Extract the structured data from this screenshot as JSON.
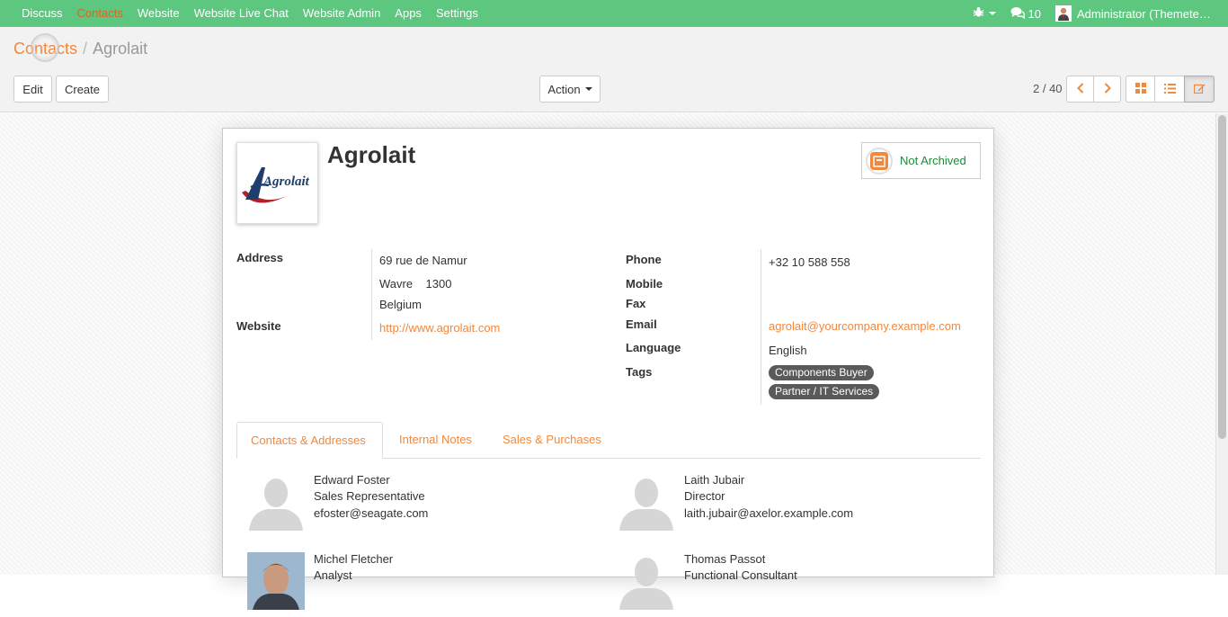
{
  "topbar": {
    "menu": [
      {
        "label": "Discuss",
        "active": false
      },
      {
        "label": "Contacts",
        "active": true
      },
      {
        "label": "Website",
        "active": false
      },
      {
        "label": "Website Live Chat",
        "active": false
      },
      {
        "label": "Website Admin",
        "active": false
      },
      {
        "label": "Apps",
        "active": false
      },
      {
        "label": "Settings",
        "active": false
      }
    ],
    "debug_icon": "bug-icon",
    "messages_icon": "comments-icon",
    "messages_count": "10",
    "user_name": "Administrator (Themete…"
  },
  "breadcrumb": {
    "parent": "Contacts",
    "separator": "/",
    "current": "Agrolait"
  },
  "toolbar": {
    "edit_label": "Edit",
    "create_label": "Create",
    "action_label": "Action",
    "pager": "2 / 40",
    "view_icons": [
      "kanban-icon",
      "list-icon",
      "form-icon"
    ],
    "active_view": "form"
  },
  "record": {
    "name": "Agrolait",
    "logo_text": "Agrolait",
    "archive_status": "Not Archived",
    "address_label": "Address",
    "street": "69 rue de Namur",
    "city_zip": "Wavre    1300",
    "country": "Belgium",
    "website_label": "Website",
    "website": "http://www.agrolait.com",
    "phone_label": "Phone",
    "phone": "+32 10 588 558",
    "mobile_label": "Mobile",
    "fax_label": "Fax",
    "email_label": "Email",
    "email": "agrolait@yourcompany.example.com",
    "language_label": "Language",
    "language": "English",
    "tags_label": "Tags",
    "tags": [
      "Components Buyer",
      "Partner / IT Services"
    ]
  },
  "tabs": [
    {
      "label": "Contacts & Addresses",
      "active": true
    },
    {
      "label": "Internal Notes",
      "active": false
    },
    {
      "label": "Sales & Purchases",
      "active": false
    }
  ],
  "contacts": [
    {
      "name": "Edward Foster",
      "function": "Sales Representative",
      "email": "efoster@seagate.com",
      "photo": "placeholder"
    },
    {
      "name": "Laith Jubair",
      "function": "Director",
      "email": "laith.jubair@axelor.example.com",
      "photo": "placeholder"
    },
    {
      "name": "Michel Fletcher",
      "function": "Analyst",
      "email": "",
      "photo": "portrait"
    },
    {
      "name": "Thomas Passot",
      "function": "Functional Consultant",
      "email": "",
      "photo": "placeholder"
    }
  ],
  "colors": {
    "navbar": "#5ec77f",
    "accent": "#f0883e",
    "active_menu": "#e0621b",
    "archived_green": "#1e8a3a",
    "tag_bg": "#5a5a5a"
  }
}
